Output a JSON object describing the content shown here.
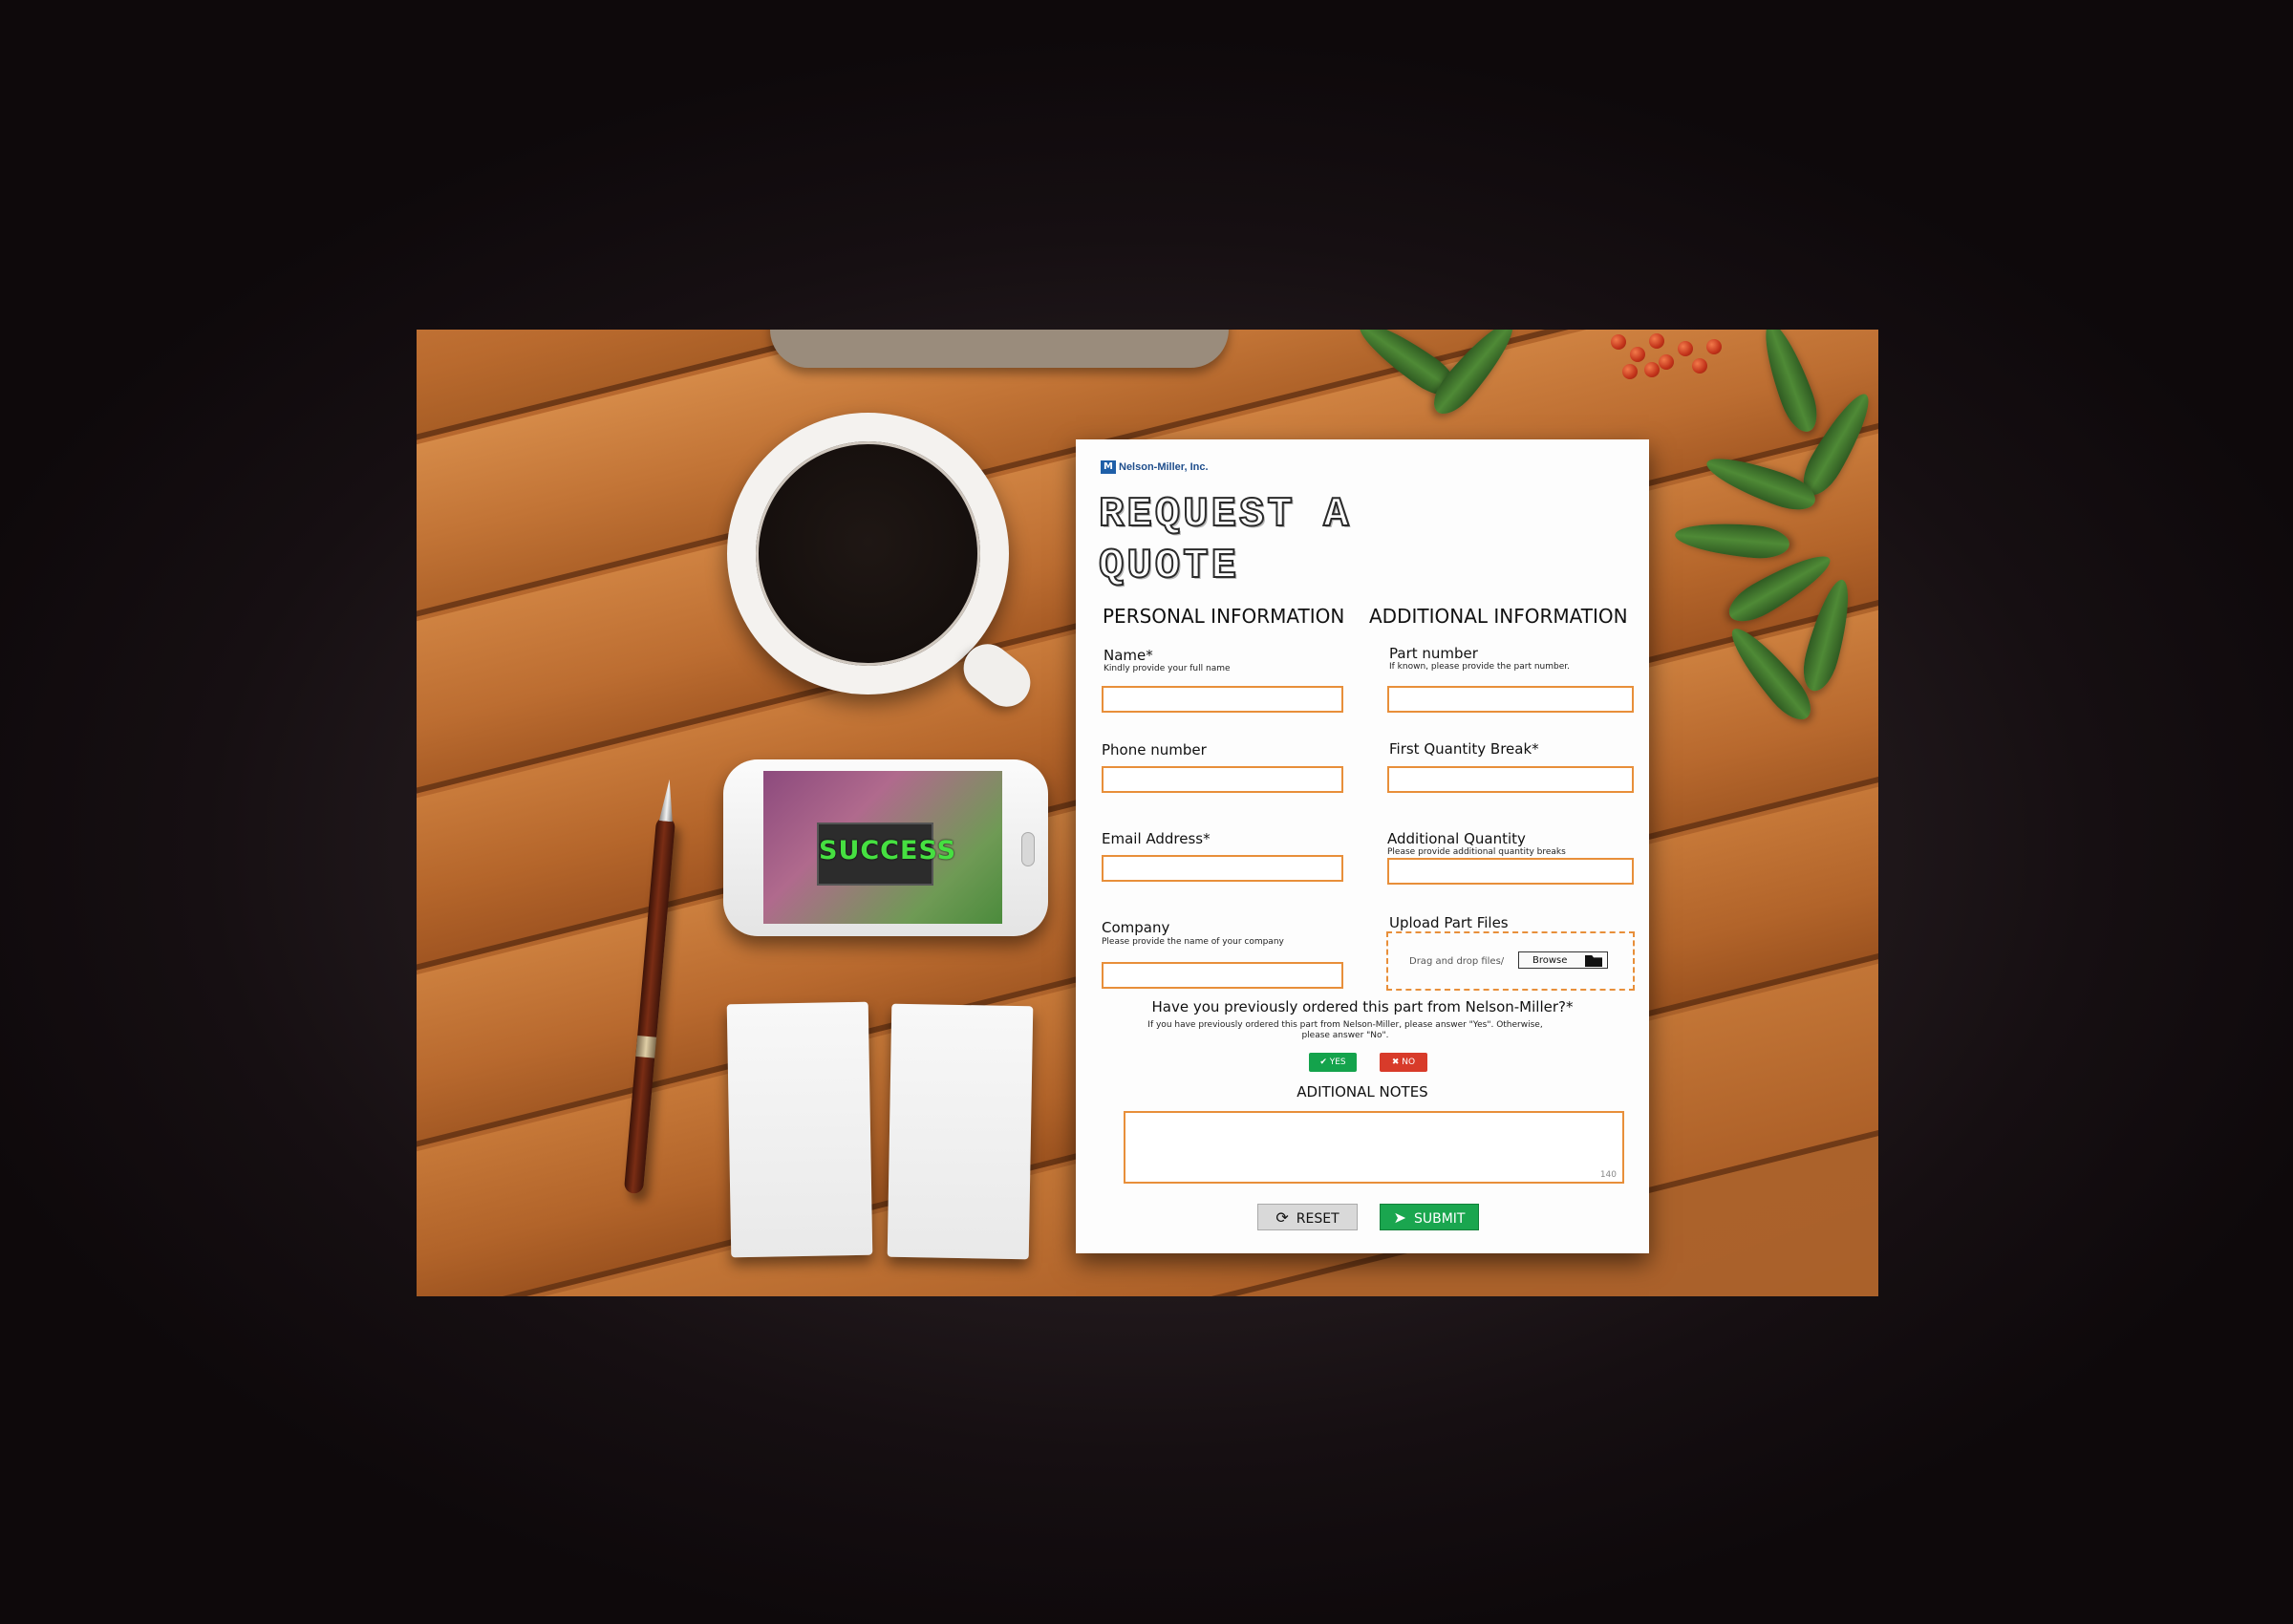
{
  "phone": {
    "screen_text": "SUCCESS"
  },
  "form": {
    "logo": {
      "mark": "M",
      "text": "Nelson-Miller, Inc."
    },
    "title": "REQUEST A QUOTE",
    "personal_heading": "PERSONAL INFORMATION",
    "additional_heading": "ADDITIONAL INFORMATION",
    "name": {
      "label": "Name*",
      "hint": "Kindly provide your full name",
      "value": ""
    },
    "phone": {
      "label": "Phone number",
      "value": ""
    },
    "email": {
      "label": "Email Address*",
      "value": ""
    },
    "company": {
      "label": "Company",
      "hint": "Please provide the name of your company",
      "value": ""
    },
    "part_number": {
      "label": "Part number",
      "hint": "If known, please provide the part number.",
      "value": ""
    },
    "first_qty": {
      "label": "First Quantity Break*",
      "value": ""
    },
    "additional_qty": {
      "label": "Additional Quantity",
      "hint": "Please provide additional quantity breaks",
      "value": ""
    },
    "upload": {
      "label": "Upload Part Files",
      "drop_text": "Drag and drop files/",
      "browse_label": "Browse"
    },
    "question": "Have you previously ordered this part from Nelson-Miller?*",
    "question_hint": "If you have previously ordered this part from Nelson-Miller, please answer \"Yes\". Otherwise, please answer \"No\".",
    "yes_label": "YES",
    "no_label": "NO",
    "notes_heading": "ADITIONAL NOTES",
    "notes_counter": "140",
    "reset_label": "RESET",
    "submit_label": "SUBMIT"
  },
  "colors": {
    "field_border": "#e88f3a",
    "yes": "#14a34c",
    "no": "#d83b2a",
    "submit": "#1aa64f",
    "logo_blue": "#1f5fa8"
  },
  "icons": [
    "check-icon",
    "x-icon",
    "refresh-icon",
    "send-icon",
    "folder-icon"
  ]
}
